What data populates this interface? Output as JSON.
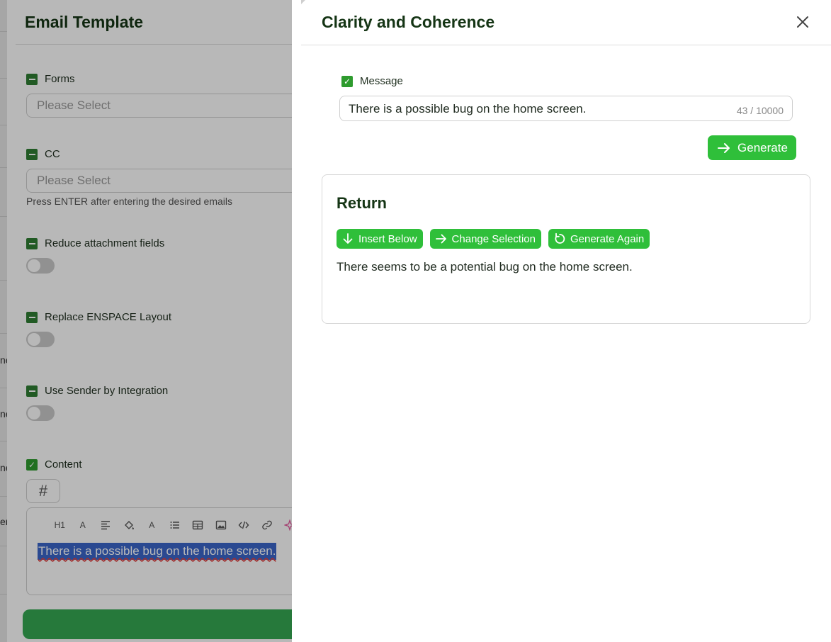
{
  "background_panel": {
    "title": "Email Template",
    "forms": {
      "label": "Forms",
      "placeholder": "Please Select"
    },
    "cc": {
      "label": "CC",
      "placeholder": "Please Select",
      "hint": "Press ENTER after entering the desired emails"
    },
    "toggles": [
      {
        "label": "Reduce attachment fields",
        "on": false
      },
      {
        "label": "Replace ENSPACE Layout",
        "on": false
      },
      {
        "label": "Use Sender by Integration",
        "on": false
      }
    ],
    "content": {
      "label": "Content",
      "hash": "#",
      "toolbar": [
        "H1",
        "A",
        "align-icon",
        "paint-bucket-icon",
        "A",
        "list-icon",
        "table-icon",
        "image-icon",
        "code-icon",
        "link-icon",
        "sparkle-icon"
      ],
      "selected_text": "There is a possible bug on the home screen."
    },
    "left_edge_fragments": [
      "ne",
      "ne",
      "ne",
      "er"
    ]
  },
  "drawer": {
    "title": "Clarity and Coherence",
    "message": {
      "label": "Message",
      "checked": true,
      "value": "There is a possible bug on the home screen.",
      "counter": "43 / 10000"
    },
    "generate_label": "Generate",
    "return": {
      "title": "Return",
      "actions": {
        "insert_below": "Insert Below",
        "change_selection": "Change Selection",
        "generate_again": "Generate Again"
      },
      "text": "There seems to be a potential bug on the home screen."
    }
  },
  "colors": {
    "accent_green": "#2fbf3a",
    "heading_green": "#153515",
    "selection_blue": "#3b66c9"
  }
}
